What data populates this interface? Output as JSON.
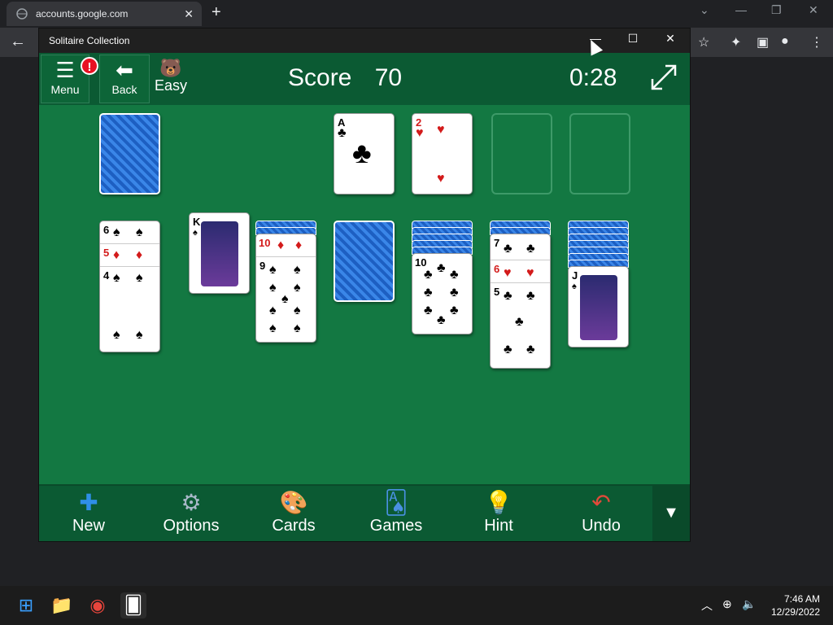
{
  "browser": {
    "tab_title": "accounts.google.com",
    "tab_close": "✕",
    "new_tab": "+",
    "minimize": "—",
    "restore": "❐",
    "close": "✕",
    "back": "←"
  },
  "app": {
    "window_title": "Solitaire Collection",
    "title_min": "—",
    "title_max": "☐",
    "title_close": "✕",
    "header": {
      "menu_label": "Menu",
      "menu_badge": "!",
      "back_label": "Back",
      "difficulty": "Easy",
      "score_label": "Score",
      "score_value": "70",
      "timer": "0:28"
    },
    "foundations": [
      {
        "rank": "A",
        "suit": "♣",
        "color": "black"
      },
      {
        "rank": "2",
        "suit": "♥",
        "color": "red"
      }
    ],
    "tableau": {
      "col1": [
        {
          "rank": "6",
          "suit": "♠"
        },
        {
          "rank": "5",
          "suit": "♦"
        },
        {
          "rank": "4",
          "suit": "♠"
        }
      ],
      "col2": {
        "rank": "K",
        "suit": "♠"
      },
      "col3": [
        {
          "rank": "10",
          "suit": "♦"
        },
        {
          "rank": "9",
          "suit": "♠"
        }
      ],
      "col5": {
        "rank": "10",
        "suit": "♣"
      },
      "col6": [
        {
          "rank": "7",
          "suit": "♣"
        },
        {
          "rank": "6",
          "suit": "♥"
        },
        {
          "rank": "5",
          "suit": "♣"
        }
      ],
      "col7": {
        "rank": "J",
        "suit": "♠"
      }
    },
    "bottom_bar": {
      "new": "New",
      "options": "Options",
      "cards": "Cards",
      "games": "Games",
      "hint": "Hint",
      "undo": "Undo",
      "more": "▼"
    }
  },
  "taskbar": {
    "time": "7:46 AM",
    "date": "12/29/2022"
  }
}
